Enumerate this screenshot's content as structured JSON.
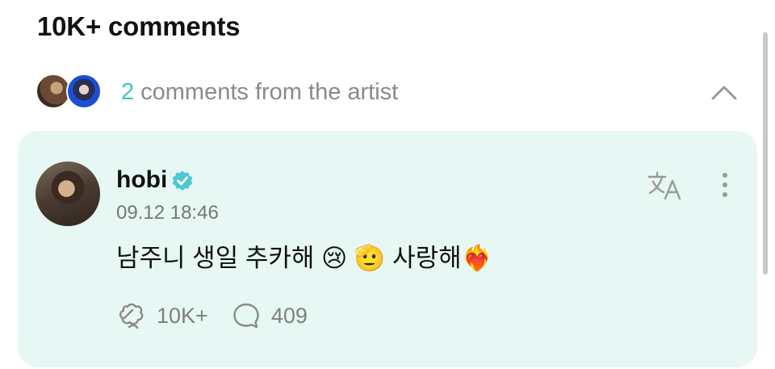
{
  "header": {
    "title": "10K+ comments"
  },
  "artist_comments": {
    "count": "2",
    "label": "comments from the artist",
    "collapse_icon": "chevron-up-icon",
    "count_color": "#3fc4c4"
  },
  "comment": {
    "username": "hobi",
    "verified_icon": "verified-badge-icon",
    "timestamp": "09.12 18:46",
    "text": "남주니 생일 추카해 😢 🫡 사랑해❤️‍🔥",
    "translate_icon": "translate-icon",
    "more_icon": "more-vertical-icon",
    "likes": "10K+",
    "replies": "409",
    "card_color": "#e6f7f4"
  }
}
